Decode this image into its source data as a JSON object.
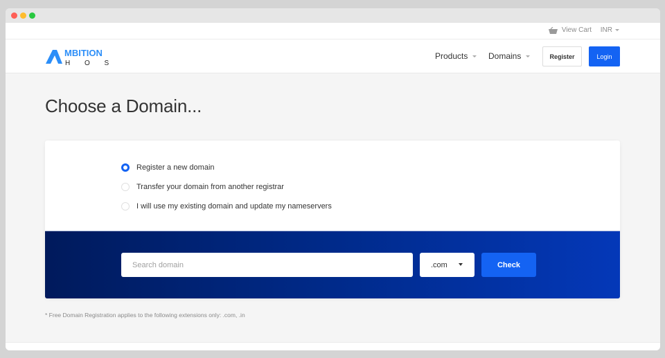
{
  "topbar": {
    "view_cart": "View Cart",
    "currency": "INR"
  },
  "navbar": {
    "logo_line1": "MBITION",
    "logo_line2": "H O S T",
    "brand_color": "#2c8ef8",
    "items": [
      {
        "label": "Products"
      },
      {
        "label": "Domains"
      }
    ],
    "register": "Register",
    "login": "Login"
  },
  "main": {
    "title": "Choose a Domain...",
    "options": [
      {
        "label": "Register a new domain",
        "checked": true
      },
      {
        "label": "Transfer your domain from another registrar",
        "checked": false
      },
      {
        "label": "I will use my existing domain and update my nameservers",
        "checked": false
      }
    ],
    "search": {
      "placeholder": "Search domain",
      "value": "",
      "tld_selected": ".com",
      "check_label": "Check"
    },
    "footnote": "* Free Domain Registration applies to the following extensions only: .com, .in"
  },
  "colors": {
    "accent": "#1463f3",
    "band_start": "#001a5c",
    "band_end": "#0438b8"
  }
}
